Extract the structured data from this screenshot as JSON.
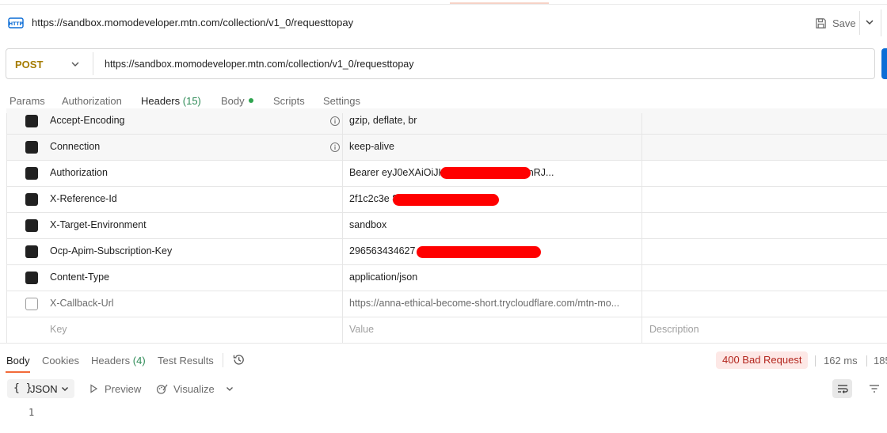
{
  "request": {
    "title": "https://sandbox.momodeveloper.mtn.com/collection/v1_0/requesttopay",
    "save_label": "Save",
    "method": "POST",
    "url": "https://sandbox.momodeveloper.mtn.com/collection/v1_0/requesttopay"
  },
  "tabs": [
    {
      "label": "Params"
    },
    {
      "label": "Authorization"
    },
    {
      "label": "Headers",
      "count": "(15)"
    },
    {
      "label": "Body"
    },
    {
      "label": "Scripts"
    },
    {
      "label": "Settings"
    }
  ],
  "headers": [
    {
      "key": "Accept-Encoding",
      "value": "gzip, deflate, br",
      "checked": true,
      "info": true
    },
    {
      "key": "Connection",
      "value": "keep-alive",
      "checked": true,
      "info": true
    },
    {
      "key": "Authorization",
      "value": "Bearer eyJ0eXAiOiJK                       MjU2In0.eyJjbGllbnRJ...",
      "checked": true
    },
    {
      "key": "X-Reference-Id",
      "value": "2f1c2c3e                              8cf0ec3d",
      "checked": true
    },
    {
      "key": "X-Target-Environment",
      "value": "sandbox",
      "checked": true
    },
    {
      "key": "Ocp-Apim-Subscription-Key",
      "value": "296563434627",
      "checked": true
    },
    {
      "key": "Content-Type",
      "value": "application/json",
      "checked": true
    },
    {
      "key": "X-Callback-Url",
      "value": "https://anna-ethical-become-short.trycloudflare.com/mtn-mo...",
      "checked": false
    }
  ],
  "placeholder_row": {
    "key": "Key",
    "value": "Value",
    "description": "Description"
  },
  "response": {
    "tabs": [
      {
        "label": "Body"
      },
      {
        "label": "Cookies"
      },
      {
        "label": "Headers",
        "count": "(4)"
      },
      {
        "label": "Test Results"
      }
    ],
    "status": "400 Bad Request",
    "time": "162 ms",
    "size": "185",
    "format": "JSON",
    "preview_label": "Preview",
    "visualize_label": "Visualize",
    "line_number": "1"
  },
  "colors": {
    "accent": "#f26b3a",
    "method": "#a57c00",
    "send": "#0c6dd6",
    "status_bg": "#fde8e6",
    "status_fg": "#b3261e"
  }
}
